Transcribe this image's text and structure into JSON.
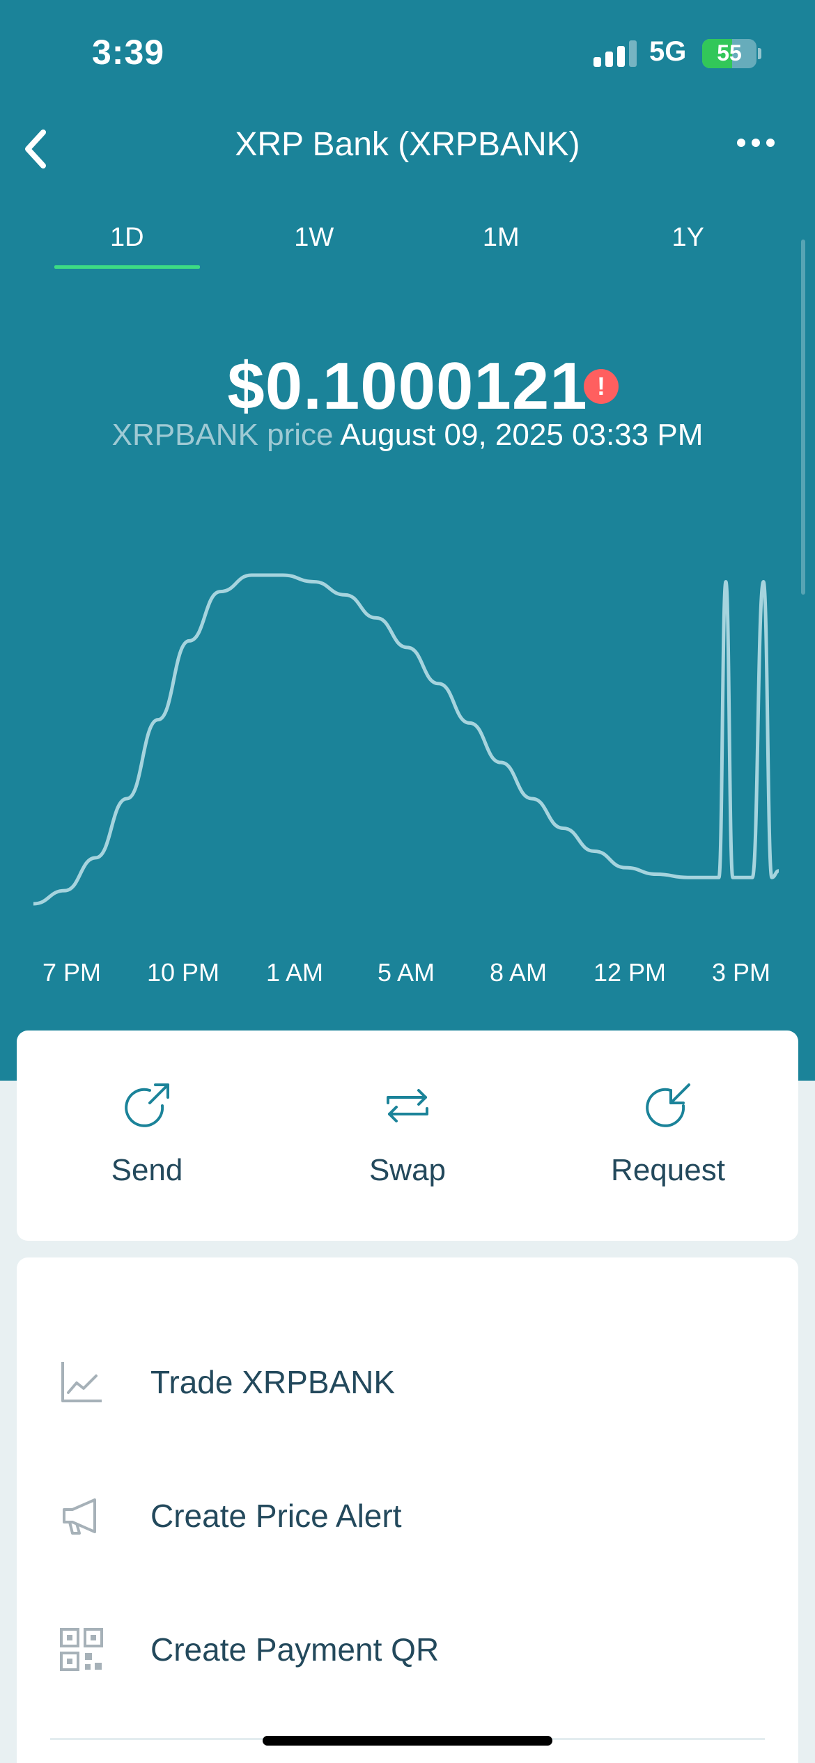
{
  "status_bar": {
    "time": "3:39",
    "network": "5G",
    "battery": "55",
    "battery_level": 0.55,
    "signal_bars": 3
  },
  "header": {
    "title": "XRP Bank (XRPBANK)",
    "back_icon": "chevron-left-icon",
    "more_icon": "ellipsis-icon"
  },
  "tabs": [
    {
      "label": "1D",
      "active": true
    },
    {
      "label": "1W",
      "active": false
    },
    {
      "label": "1M",
      "active": false
    },
    {
      "label": "1Y",
      "active": false
    }
  ],
  "price": {
    "value": "$0.1000121",
    "label": "XRPBANK price",
    "timestamp": "August 09, 2025 03:33 PM",
    "warning_icon": "alert-icon"
  },
  "chart_data": {
    "type": "line",
    "x_ticks": [
      "7 PM",
      "10 PM",
      "1 AM",
      "5 AM",
      "8 AM",
      "12 PM",
      "3 PM"
    ],
    "series": [
      {
        "values": [
          0.0,
          0.04,
          0.14,
          0.32,
          0.56,
          0.8,
          0.95,
          1.0,
          1.0,
          0.98,
          0.94,
          0.87,
          0.78,
          0.67,
          0.55,
          0.43,
          0.32,
          0.23,
          0.16,
          0.11,
          0.09,
          0.08,
          0.08,
          0.98,
          0.08,
          0.08,
          0.98,
          0.08,
          0.1
        ]
      }
    ],
    "grid": false,
    "legend": "none"
  },
  "colors": {
    "header_bg": "#1b8399",
    "accent_tab": "#3ddc84",
    "line": "#a6d4de",
    "warning": "#ff5f5f",
    "text_dark": "#23495c"
  },
  "actions": [
    {
      "label": "Send",
      "icon": "send-icon"
    },
    {
      "label": "Swap",
      "icon": "swap-icon"
    },
    {
      "label": "Request",
      "icon": "request-icon"
    }
  ],
  "menu": [
    {
      "label": "Trade XRPBANK",
      "icon": "trend-chart-icon"
    },
    {
      "label": "Create Price Alert",
      "icon": "megaphone-icon"
    },
    {
      "label": "Create Payment QR",
      "icon": "qr-code-icon"
    }
  ]
}
